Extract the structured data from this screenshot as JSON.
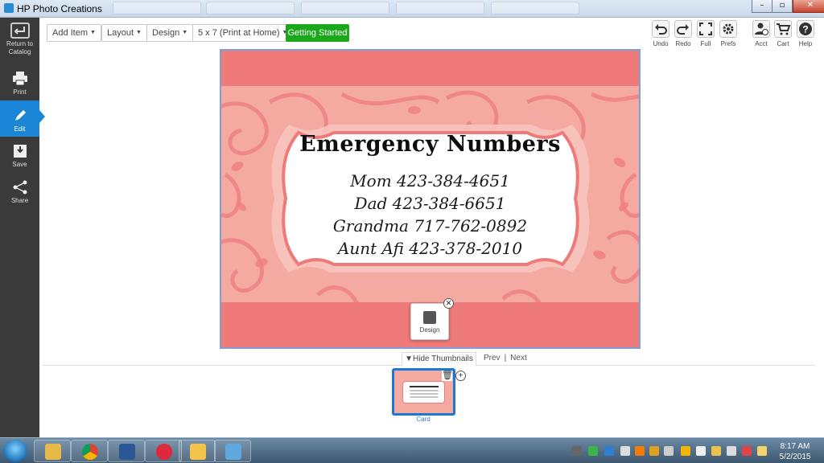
{
  "window": {
    "title": "HP Photo Creations"
  },
  "sidebar": {
    "items": [
      {
        "label_1": "Return to",
        "label_2": "Catalog"
      },
      {
        "label": "Print"
      },
      {
        "label": "Edit"
      },
      {
        "label": "Save"
      },
      {
        "label": "Share"
      }
    ]
  },
  "toolbar": {
    "add_item": "Add Item",
    "layout": "Layout",
    "design": "Design",
    "size": "5 x 7 (Print at Home)",
    "getting_started": "Getting Started",
    "right": [
      {
        "label": "Undo",
        "icon": "undo-icon"
      },
      {
        "label": "Redo",
        "icon": "redo-icon"
      },
      {
        "label": "Full",
        "icon": "fullscreen-icon"
      },
      {
        "label": "Prefs",
        "icon": "gear-icon"
      },
      {
        "label": "Acct",
        "icon": "account-icon"
      },
      {
        "label": "Cart",
        "icon": "cart-icon"
      },
      {
        "label": "Help",
        "icon": "help-icon"
      }
    ]
  },
  "card": {
    "title": "Emergency Numbers",
    "lines": [
      "Mom   423-384-4651",
      "Dad 423-384-6651",
      "Grandma 717-762-0892",
      "Aunt Afi 423-378-2010"
    ],
    "colors": {
      "band": "#ee7a7a",
      "background": "#f4aaa0",
      "swirl": "#ee8282"
    }
  },
  "design_popup": {
    "label": "Design",
    "close": "✕"
  },
  "thumbnails": {
    "toggle": "▼Hide Thumbnails",
    "prev": "Prev",
    "separator": "|",
    "next": "Next",
    "items": [
      {
        "label": "Card"
      }
    ]
  },
  "taskbar": {
    "time": "8:17 AM",
    "date": "5/2/2015"
  }
}
